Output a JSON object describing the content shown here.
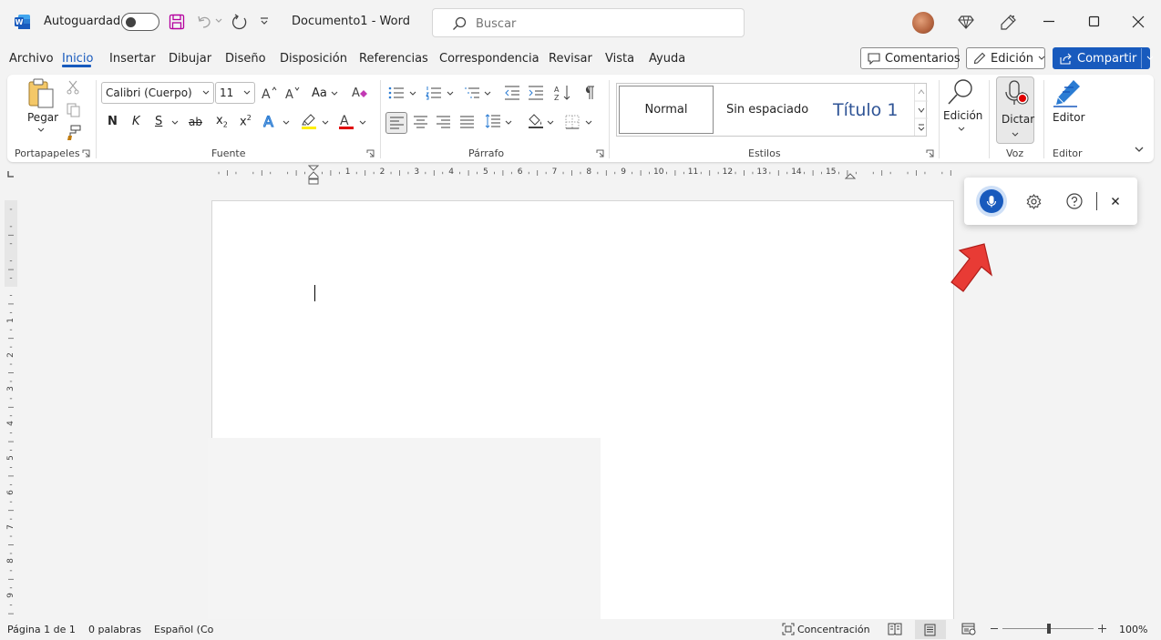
{
  "titlebar": {
    "autosave_label": "Autoguardado",
    "document_title": "Documento1  -  Word",
    "search_placeholder": "Buscar",
    "brand_color": "#185abd"
  },
  "menu": {
    "items": [
      "Archivo",
      "Inicio",
      "Insertar",
      "Dibujar",
      "Diseño",
      "Disposición",
      "Referencias",
      "Correspondencia",
      "Revisar",
      "Vista",
      "Ayuda"
    ],
    "active": "Inicio",
    "comments_label": "Comentarios",
    "editing_label": "Edición",
    "share_label": "Compartir"
  },
  "ribbon": {
    "clipboard": {
      "paste_label": "Pegar",
      "group_label": "Portapapeles"
    },
    "font": {
      "name": "Calibri (Cuerpo)",
      "size": "11",
      "change_case": "Aa",
      "bold": "N",
      "italic": "K",
      "underline": "S",
      "strike": "ab",
      "subscript": "x",
      "superscript": "x",
      "group_label": "Fuente"
    },
    "paragraph": {
      "group_label": "Párrafo"
    },
    "styles": {
      "items": [
        "Normal",
        "Sin espaciado",
        "Título 1"
      ],
      "group_label": "Estilos"
    },
    "editing": {
      "label": "Edición"
    },
    "voice": {
      "dictate_label": "Dictar",
      "group_label": "Voz"
    },
    "editor": {
      "label": "Editor",
      "group_label": "Editor"
    }
  },
  "ruler": {
    "numbers": [
      "1",
      "2",
      "3",
      "4",
      "5",
      "6",
      "7",
      "8",
      "9",
      "10",
      "11",
      "12",
      "13",
      "14",
      "15"
    ],
    "vertical_numbers": [
      "1",
      "2",
      "3",
      "4",
      "5",
      "6",
      "7",
      "8",
      "9"
    ]
  },
  "statusbar": {
    "page": "Página 1 de 1",
    "words": "0 palabras",
    "language": "Español (Co",
    "focus": "Concentración",
    "zoom": "100%"
  }
}
